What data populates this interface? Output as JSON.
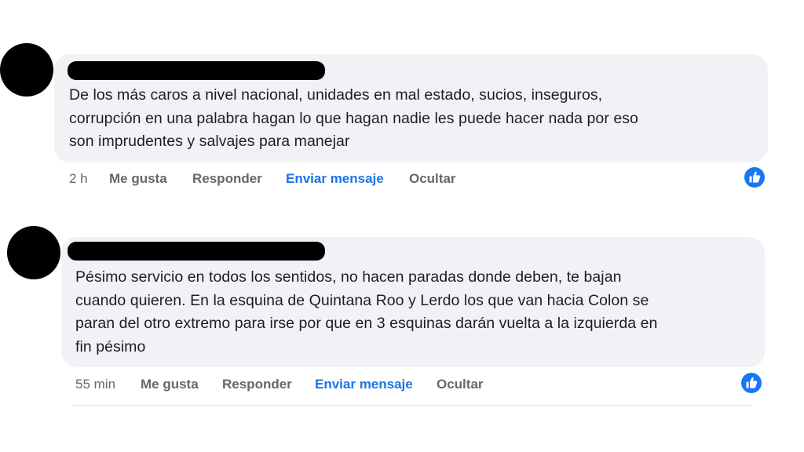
{
  "colors": {
    "accent": "#1b74e4",
    "bubble": "#f0f2f5",
    "meta": "#65676b",
    "like": "#1877f2"
  },
  "comments": [
    {
      "text_lines": [
        "De los más caros a nivel nacional, unidades en mal estado, sucios, inseguros,",
        "corrupción en una palabra hagan lo que hagan nadie les puede hacer nada por eso",
        "son imprudentes y salvajes para manejar"
      ],
      "time": "2 h",
      "like_label": "Me gusta",
      "reply_label": "Responder",
      "message_label": "Enviar mensaje",
      "hide_label": "Ocultar",
      "reaction_icon": "like-icon"
    },
    {
      "text_lines": [
        "Pésimo servicio en todos los sentidos, no hacen paradas donde deben, te bajan",
        "cuando quieren. En la esquina de Quintana Roo y Lerdo los que van hacia Colon se",
        "paran del otro extremo para irse por que en 3 esquinas darán vuelta a la izquierda en",
        "fin pésimo"
      ],
      "time": "55 min",
      "like_label": "Me gusta",
      "reply_label": "Responder",
      "message_label": "Enviar mensaje",
      "hide_label": "Ocultar",
      "reaction_icon": "like-icon"
    }
  ]
}
